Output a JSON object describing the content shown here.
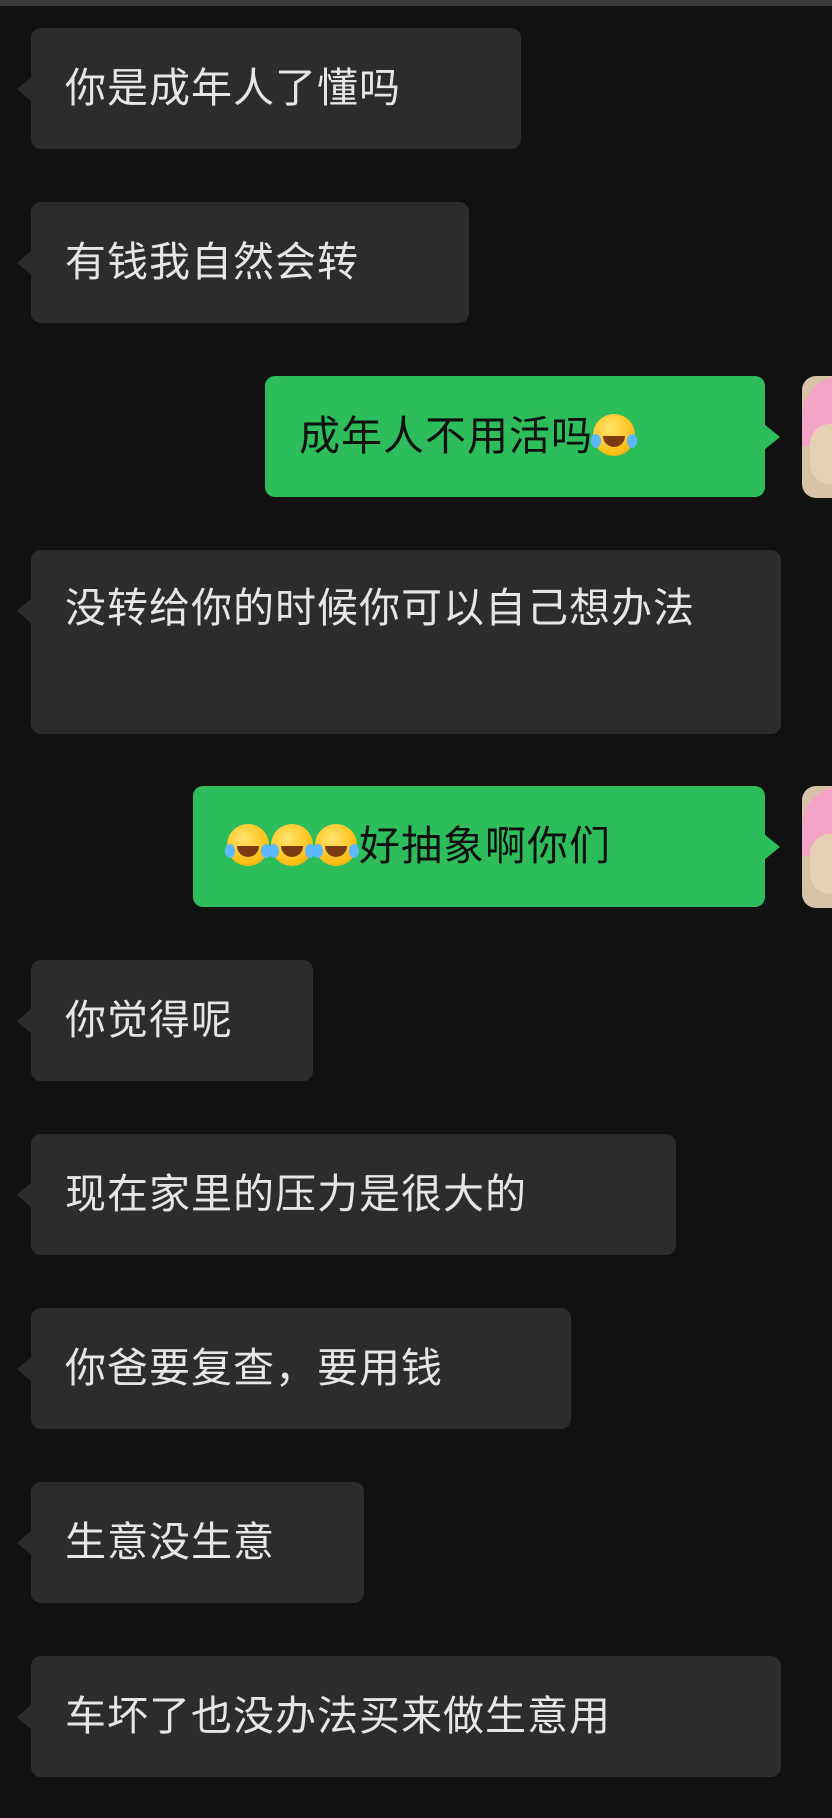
{
  "conversation": {
    "messages": [
      {
        "side": "in",
        "text": "你是成年人了懂吗"
      },
      {
        "side": "in",
        "text": "有钱我自然会转"
      },
      {
        "side": "out",
        "text": "成年人不用活吗",
        "emoji_after": "loudly-crying-laughing-emoji"
      },
      {
        "side": "in",
        "text": "没转给你的时候你可以自己想办法"
      },
      {
        "side": "out",
        "emoji_before_count": 3,
        "text": "好抽象啊你们",
        "emoji_before": "loudly-crying-laughing-emoji"
      },
      {
        "side": "in",
        "text": "你觉得呢"
      },
      {
        "side": "in",
        "text": "现在家里的压力是很大的"
      },
      {
        "side": "in",
        "text": "你爸要复查，要用钱"
      },
      {
        "side": "in",
        "text": "生意没生意"
      },
      {
        "side": "in",
        "text": "车坏了也没办法买来做生意用"
      }
    ]
  },
  "theme": {
    "background": "#111111",
    "incoming_bubble": "#2c2c2c",
    "outgoing_bubble": "#2dbd5b",
    "incoming_text": "#e6e6e6",
    "outgoing_text": "#101010"
  }
}
